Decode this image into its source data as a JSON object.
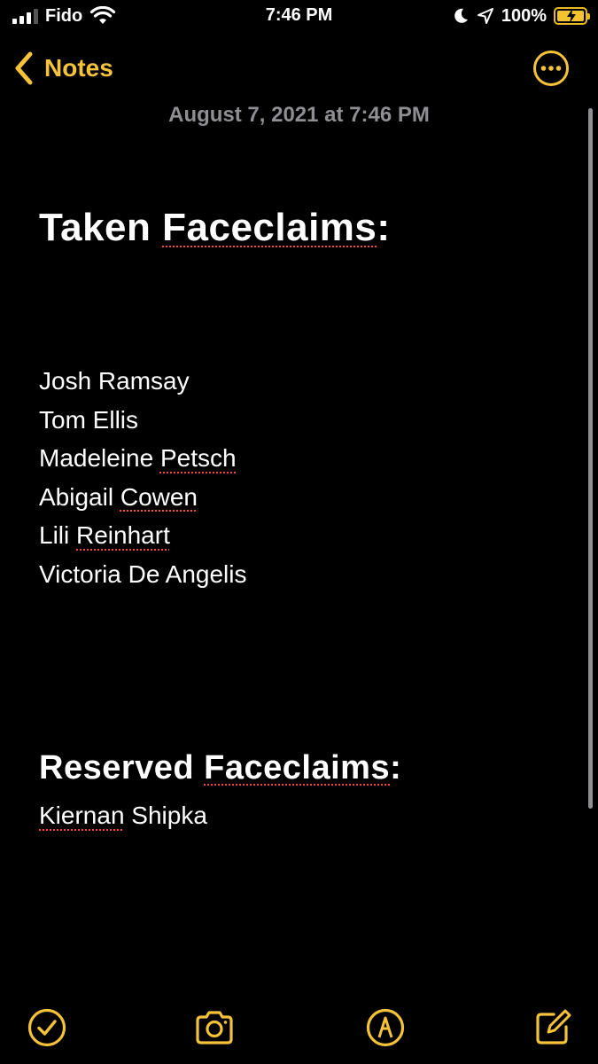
{
  "status_bar": {
    "carrier": "Fido",
    "time": "7:46 PM",
    "battery_percent": "100%",
    "icons": [
      "signal-icon",
      "wifi-icon",
      "moon-icon",
      "location-icon",
      "battery-charging-icon"
    ]
  },
  "nav": {
    "back_label": "Notes",
    "more_icon": "ellipsis-circle-icon"
  },
  "note": {
    "timestamp": "August 7, 2021 at 7:46 PM",
    "taken_heading_word1": "Taken ",
    "taken_heading_word2": "Faceclaims",
    "taken_heading_word3": ":",
    "taken": [
      {
        "first": "Josh Ramsay",
        "last": ""
      },
      {
        "first": "Tom Ellis",
        "last": ""
      },
      {
        "first": "Madeleine ",
        "last": "Petsch"
      },
      {
        "first": "Abigail ",
        "last": "Cowen"
      },
      {
        "first": "Lili ",
        "last": "Reinhart"
      },
      {
        "first": "Victoria De Angelis",
        "last": ""
      }
    ],
    "reserved_heading_word1": "Reserved ",
    "reserved_heading_word2": "Faceclaims",
    "reserved_heading_word3": ":",
    "reserved_first": "Kiernan",
    "reserved_last": " Shipka"
  },
  "toolbar": {
    "icons": [
      "checklist-icon",
      "camera-icon",
      "markup-icon",
      "compose-icon"
    ]
  },
  "colors": {
    "accent": "#f5c23a",
    "background": "#000000",
    "text": "#ffffff",
    "secondary_text": "#8e8e93",
    "spellcheck": "#ff453a"
  }
}
